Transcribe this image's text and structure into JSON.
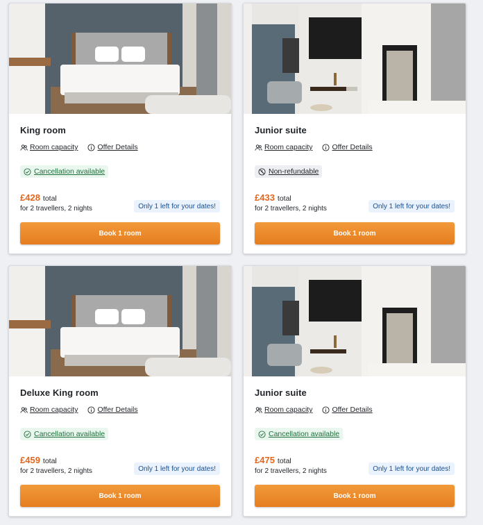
{
  "offers": [
    {
      "room_name": "King room",
      "room_capacity_label": "Room capacity",
      "offer_details_label": "Offer Details",
      "policy": "Cancellation available",
      "policy_type": "cancellable",
      "price": "£428",
      "price_suffix": "total",
      "stay_info": "for 2 travellers, 2 nights",
      "availability": "Only 1 left for your dates!",
      "book_label": "Book 1 room"
    },
    {
      "room_name": "Junior suite",
      "room_capacity_label": "Room capacity",
      "offer_details_label": "Offer Details",
      "policy": "Non-refundable",
      "policy_type": "non-refundable",
      "price": "£433",
      "price_suffix": "total",
      "stay_info": "for 2 travellers, 2 nights",
      "availability": "Only 1 left for your dates!",
      "book_label": "Book 1 room"
    },
    {
      "room_name": "Deluxe King room",
      "room_capacity_label": "Room capacity",
      "offer_details_label": "Offer Details",
      "policy": "Cancellation available",
      "policy_type": "cancellable",
      "price": "£459",
      "price_suffix": "total",
      "stay_info": "for 2 travellers, 2 nights",
      "availability": "Only 1 left for your dates!",
      "book_label": "Book 1 room"
    },
    {
      "room_name": "Junior suite",
      "room_capacity_label": "Room capacity",
      "offer_details_label": "Offer Details",
      "policy": "Cancellation available",
      "policy_type": "cancellable",
      "price": "£475",
      "price_suffix": "total",
      "stay_info": "for 2 travellers, 2 nights",
      "availability": "Only 1 left for your dates!",
      "book_label": "Book 1 room"
    }
  ],
  "colors": {
    "accent_orange": "#e57d1f",
    "price_orange": "#e2661b",
    "availability_blue": "#1d4f8c",
    "cancellation_green": "#1f6e3c"
  }
}
